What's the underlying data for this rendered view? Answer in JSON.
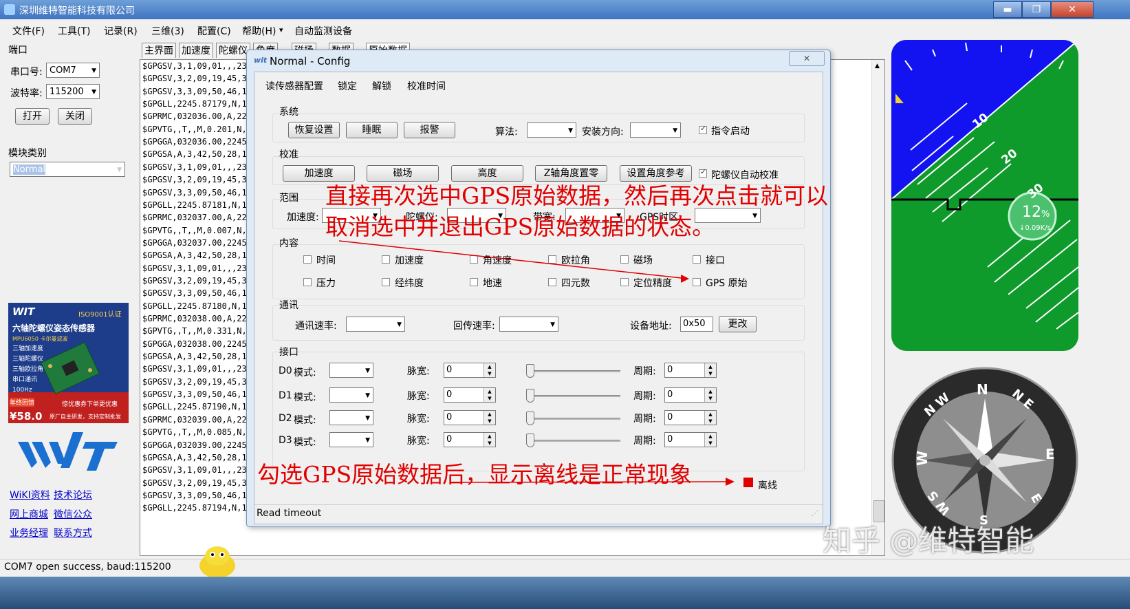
{
  "window": {
    "title": "深圳维特智能科技有限公司",
    "min": "▬",
    "max": "❐",
    "close": "✕"
  },
  "menu": [
    "文件(F)",
    "工具(T)",
    "记录(R)",
    "三维(3)",
    "配置(C)",
    "帮助(H)",
    "▾",
    "自动监测设备"
  ],
  "left": {
    "port_group": "端口",
    "port_label": "串口号:",
    "port_value": "COM7",
    "baud_label": "波特率:",
    "baud_value": "115200",
    "open": "打开",
    "close": "关闭",
    "module_group": "模块类别",
    "module_value": "Normal",
    "ad": {
      "brand": "WIT",
      "cert": "ISO9001认证",
      "title": "六轴陀螺仪姿态传感器",
      "model": "MPU6050 卡尔曼滤波",
      "features": [
        "三轴加速度",
        "三轴陀螺仪",
        "三轴欧拉角",
        "串口通讯",
        "100Hz"
      ],
      "price": "¥58.0",
      "badge": "年终回馈",
      "promo": "惊优惠券下单更优惠",
      "promo2": "原厂自主研发，支持定制批发"
    },
    "logo": "WIT",
    "links": [
      [
        "WiKI资料",
        "技术论坛"
      ],
      [
        "网上商城",
        "微信公众"
      ],
      [
        "业务经理",
        "联系方式"
      ]
    ]
  },
  "tabs": [
    "主界面",
    "加速度",
    "陀螺仪",
    "角度",
    "磁场",
    "数据",
    "原始数据"
  ],
  "data_lines": [
    "$GPGSV,3,1,09,01,,,23,",
    "$GPGSV,3,2,09,19,45,34",
    "$GPGSV,3,3,09,50,46,12",
    "$GPGLL,2245.87179,N,11",
    "$GPRMC,032036.00,A,224",
    "$GPVTG,,T,,M,0.201,N,0",
    "$GPGGA,032036.00,2245.",
    "$GPGSA,A,3,42,50,28,17",
    "$GPGSV,3,1,09,01,,,23,",
    "$GPGSV,3,2,09,19,45,34",
    "$GPGSV,3,3,09,50,46,12",
    "$GPGLL,2245.87181,N,11",
    "$GPRMC,032037.00,A,224",
    "$GPVTG,,T,,M,0.007,N,0",
    "$GPGGA,032037.00,2245.",
    "$GPGSA,A,3,42,50,28,17",
    "$GPGSV,3,1,09,01,,,23,",
    "$GPGSV,3,2,09,19,45,34",
    "$GPGSV,3,3,09,50,46,12",
    "$GPGLL,2245.87180,N,11",
    "$GPRMC,032038.00,A,224",
    "$GPVTG,,T,,M,0.331,N,0",
    "$GPGGA,032038.00,2245.",
    "$GPGSA,A,3,42,50,28,17",
    "$GPGSV,3,1,09,01,,,23,",
    "$GPGSV,3,2,09,19,45,34",
    "$GPGSV,3,3,09,50,46,12",
    "$GPGLL,2245.87190,N,11",
    "$GPRMC,032039.00,A,224",
    "$GPVTG,,T,,M,0.085,N,0",
    "$GPGGA,032039.00,2245.",
    "$GPGSA,A,3,42,50,28,17",
    "$GPGSV,3,1,09,01,,,23,",
    "$GPGSV,3,2,09,19,45,34",
    "$GPGSV,3,3,09,50,46,12",
    "$GPGLL,2245.87194,N,11"
  ],
  "dialog": {
    "title": "Normal - Config",
    "close": "✕",
    "toolbar": [
      "读传感器配置",
      "锁定",
      "解锁",
      "校准时间"
    ],
    "system": {
      "title": "系统",
      "restore": "恢复设置",
      "sleep": "睡眠",
      "alarm": "报警",
      "algo_label": "算法:",
      "mount_label": "安装方向:",
      "cmd_start": "指令启动"
    },
    "calib": {
      "title": "校准",
      "acc": "加速度",
      "mag": "磁场",
      "height": "高度",
      "zaxis": "Z轴角度置零",
      "ref": "设置角度参考",
      "gyro_auto": "陀螺仪自动校准"
    },
    "range": {
      "title": "范围",
      "acc": "加速度:",
      "gyro": "陀螺仪:",
      "bw": "带宽:",
      "tz": "GPS时区:"
    },
    "content": {
      "title": "内容",
      "items": [
        "时间",
        "加速度",
        "角速度",
        "欧拉角",
        "磁场",
        "接口",
        "压力",
        "经纬度",
        "地速",
        "四元数",
        "定位精度",
        "GPS 原始"
      ]
    },
    "comm": {
      "title": "通讯",
      "rate": "通讯速率:",
      "return_rate": "回传速率:",
      "addr_label": "设备地址:",
      "addr_value": "0x50",
      "change": "更改"
    },
    "io": {
      "title": "接口",
      "mode": "模式:",
      "pulse": "脉宽:",
      "period": "周期:",
      "rows": [
        {
          "name": "D0",
          "pulse": "0",
          "period": "0"
        },
        {
          "name": "D1",
          "pulse": "0",
          "period": "0"
        },
        {
          "name": "D2",
          "pulse": "0",
          "period": "0"
        },
        {
          "name": "D3",
          "pulse": "0",
          "period": "0"
        }
      ]
    },
    "offline": "离线",
    "status": "Read timeout",
    "offline_color": "#e00000"
  },
  "annotations": {
    "line1": "直接再次选中GPS原始数据，然后再次点击就可以",
    "line2": "取消选中并退出GPS原始数据的状态。",
    "line3": "勾选GPS原始数据后，显示离线是正常现象"
  },
  "horizon": {
    "marks": [
      "10",
      "20",
      "30"
    ],
    "percent": "12",
    "percent_sign": "%",
    "rate": "↓0.09K/s"
  },
  "compass": {
    "n": "N",
    "ne": "N E",
    "e": "E",
    "se": "E",
    "s": "S",
    "sw": "W S",
    "w": "W",
    "nw": "N W"
  },
  "watermark": "知乎 @维特智能",
  "status": "COM7 open success, baud:115200"
}
